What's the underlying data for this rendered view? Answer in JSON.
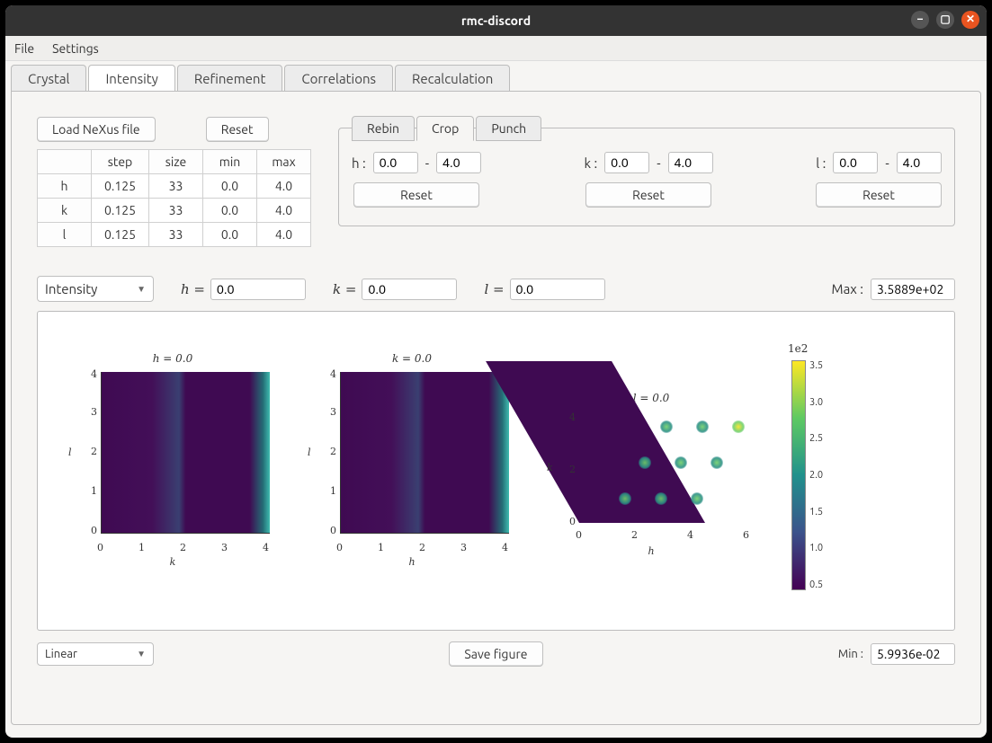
{
  "window": {
    "title": "rmc-discord"
  },
  "menu": {
    "file": "File",
    "settings": "Settings"
  },
  "tabs": {
    "crystal": "Crystal",
    "intensity": "Intensity",
    "refinement": "Refinement",
    "correlations": "Correlations",
    "recalculation": "Recalculation",
    "active": "intensity"
  },
  "buttons": {
    "load": "Load NeXus file",
    "reset": "Reset",
    "save_figure": "Save figure"
  },
  "data_table": {
    "cols": [
      "step",
      "size",
      "min",
      "max"
    ],
    "rows": [
      {
        "axis": "h",
        "step": "0.125",
        "size": "33",
        "min": "0.0",
        "max": "4.0"
      },
      {
        "axis": "k",
        "step": "0.125",
        "size": "33",
        "min": "0.0",
        "max": "4.0"
      },
      {
        "axis": "l",
        "step": "0.125",
        "size": "33",
        "min": "0.0",
        "max": "4.0"
      }
    ]
  },
  "crop": {
    "tabs": {
      "rebin": "Rebin",
      "crop": "Crop",
      "punch": "Punch",
      "active": "crop"
    },
    "sep": "-",
    "h": {
      "label": "h :",
      "lo": "0.0",
      "hi": "4.0",
      "reset": "Reset"
    },
    "k": {
      "label": "k :",
      "lo": "0.0",
      "hi": "4.0",
      "reset": "Reset"
    },
    "l": {
      "label": "l :",
      "lo": "0.0",
      "hi": "4.0",
      "reset": "Reset"
    }
  },
  "slice": {
    "mode": "Intensity",
    "h": {
      "label": "h =",
      "value": "0.0"
    },
    "k": {
      "label": "k =",
      "value": "0.0"
    },
    "l": {
      "label": "l =",
      "value": "0.0"
    },
    "max_label": "Max :",
    "max_value": "3.5889e+02"
  },
  "plots": {
    "p1": {
      "title": "h = 0.0",
      "xlabel": "k",
      "ylabel": "l",
      "xticks": [
        "0",
        "1",
        "2",
        "3",
        "4"
      ],
      "yticks": [
        "0",
        "1",
        "2",
        "3",
        "4"
      ]
    },
    "p2": {
      "title": "k = 0.0",
      "xlabel": "h",
      "ylabel": "l",
      "xticks": [
        "0",
        "1",
        "2",
        "3",
        "4"
      ],
      "yticks": [
        "0",
        "1",
        "2",
        "3",
        "4"
      ]
    },
    "p3": {
      "title": "l = 0.0",
      "xlabel": "h",
      "ylabel": "k",
      "xticks": [
        "0",
        "2",
        "4",
        "6"
      ],
      "yticks": [
        "0",
        "2",
        "4"
      ]
    },
    "cbar": {
      "title": "1e2",
      "ticks": [
        "3.5",
        "3.0",
        "2.5",
        "2.0",
        "1.5",
        "1.0",
        "0.5"
      ]
    }
  },
  "chart_data": [
    {
      "type": "heatmap",
      "title": "h = 0.0",
      "xlabel": "k",
      "ylabel": "l",
      "xlim": [
        0,
        4
      ],
      "ylim": [
        0,
        4
      ]
    },
    {
      "type": "heatmap",
      "title": "k = 0.0",
      "xlabel": "h",
      "ylabel": "l",
      "xlim": [
        0,
        4.6
      ],
      "ylim": [
        0,
        4
      ]
    },
    {
      "type": "heatmap",
      "title": "l = 0.0",
      "xlabel": "h",
      "ylabel": "k",
      "xlim": [
        0,
        6
      ],
      "ylim": [
        0,
        4
      ],
      "colorbar": {
        "title": "1e2",
        "range": [
          0.059936,
          3.5889
        ]
      }
    }
  ],
  "scale": {
    "mode": "Linear",
    "min_label": "Min :",
    "min_value": "5.9936e-02"
  }
}
